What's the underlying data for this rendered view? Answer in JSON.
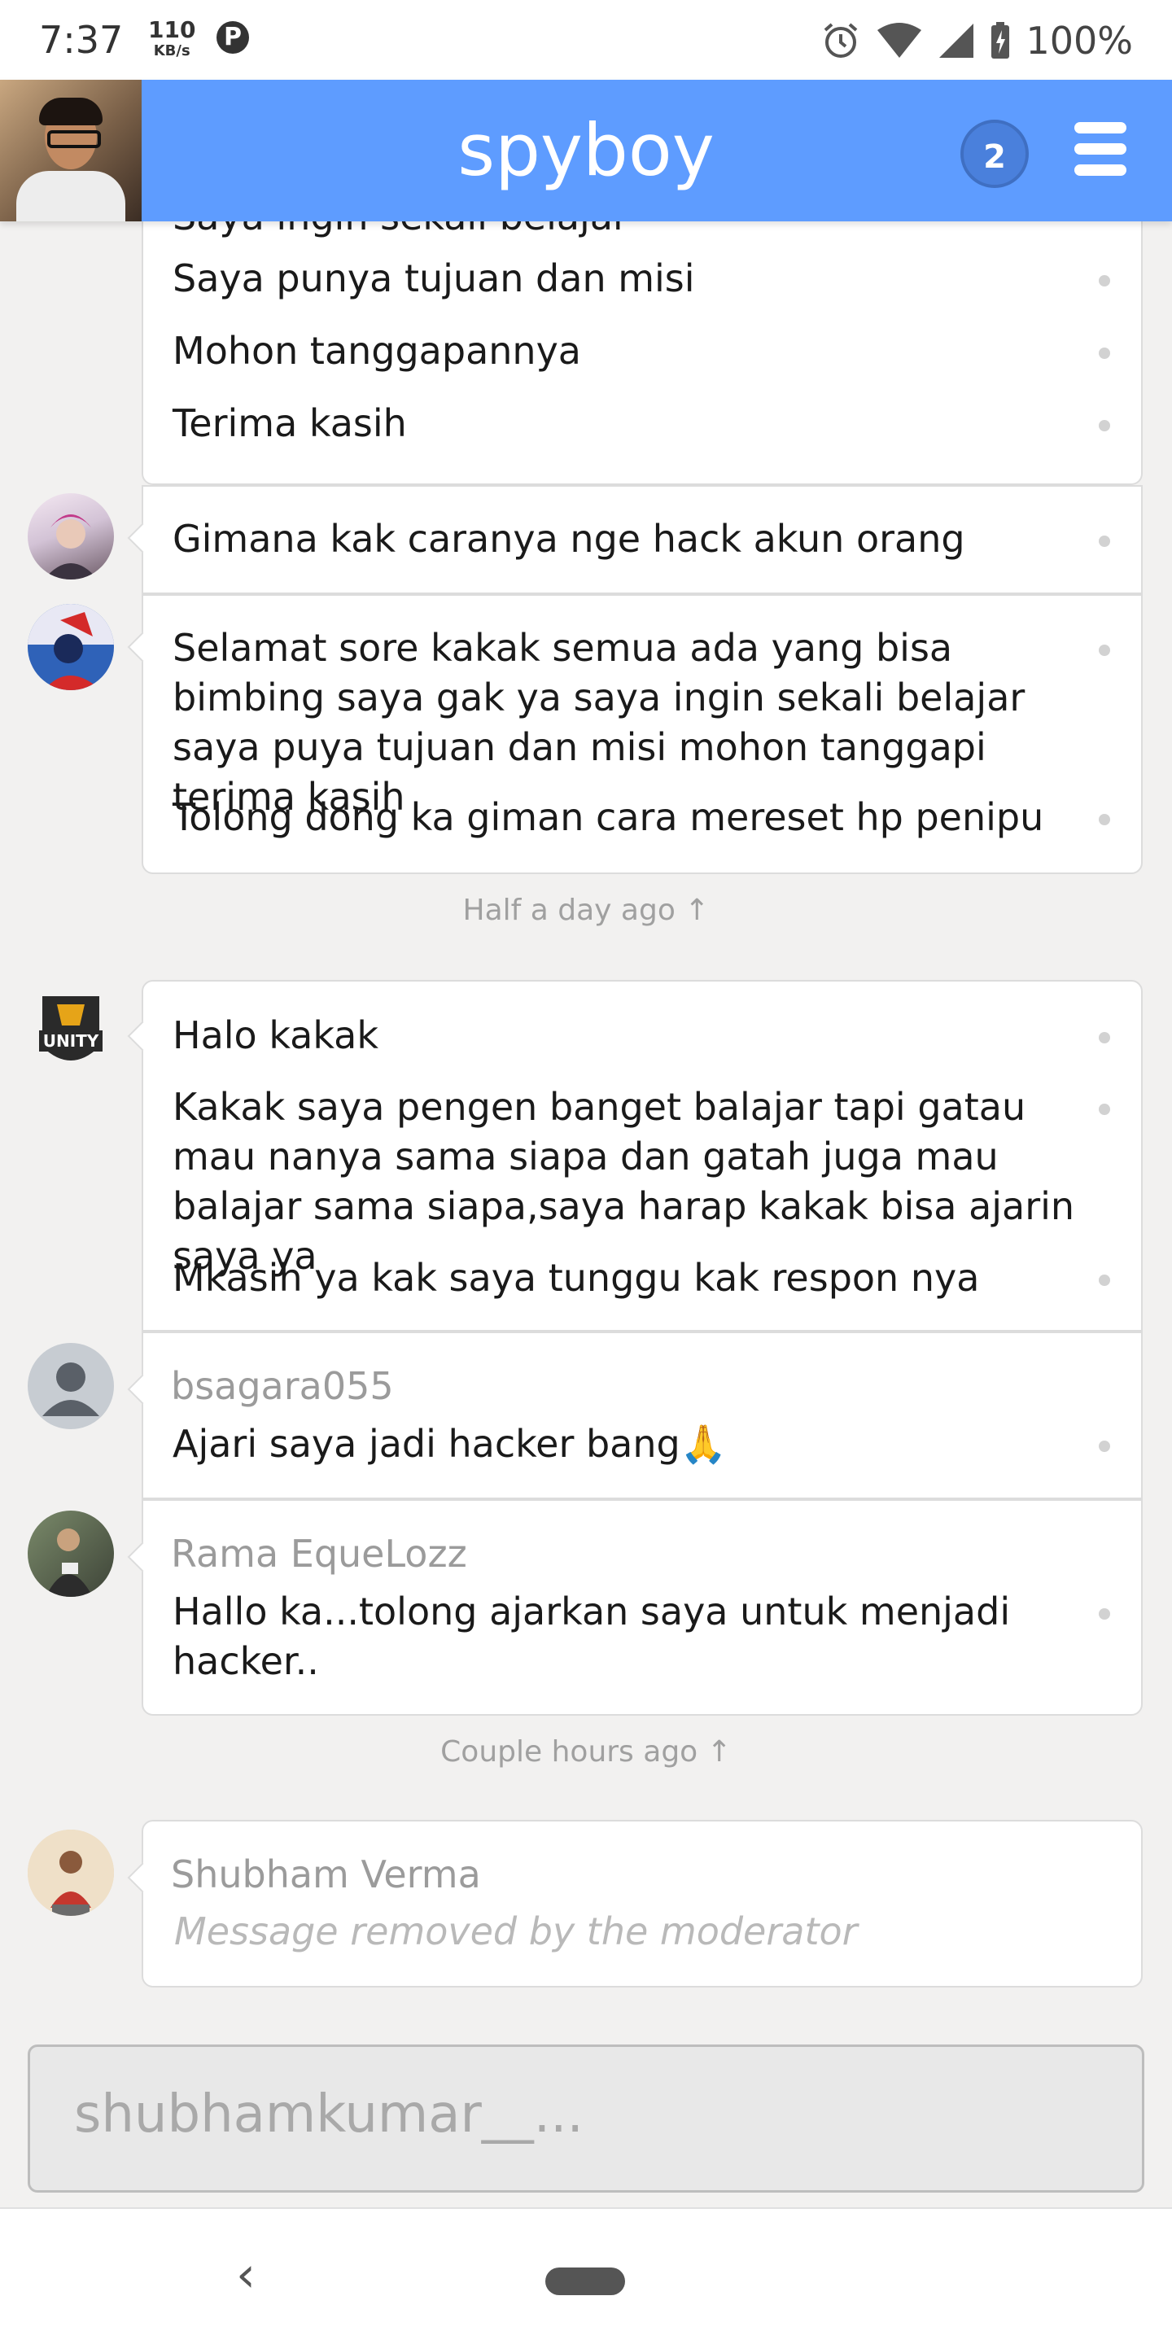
{
  "status_bar": {
    "time": "7:37",
    "speed_value": "110",
    "speed_unit": "KB/s",
    "notification_icon": "P",
    "battery": "100%"
  },
  "header": {
    "title": "spyboy",
    "badge_count": "2"
  },
  "messages": {
    "g1": {
      "partial_line": "Saya ingin sekali belajar",
      "lines": [
        "Saya punya tujuan dan misi",
        "Mohon tanggapannya",
        "Terima kasih"
      ]
    },
    "g2": {
      "lines": [
        "Gimana kak caranya nge hack akun orang"
      ]
    },
    "g3": {
      "lines": [
        "Selamat sore kakak semua ada yang bisa bimbing saya gak ya saya ingin sekali belajar saya puya tujuan dan misi mohon tanggapi terima kasih",
        "Tolong dong ka giman cara mereset hp penipu"
      ]
    },
    "ts1": "Half a day ago ↑",
    "g4": {
      "avatar_text": "UNITY",
      "lines": [
        "Halo kakak",
        "Kakak saya pengen banget balajar tapi gatau mau nanya sama siapa dan gatah juga mau balajar sama siapa,saya harap kakak bisa ajarin saya ya",
        "Mkasih ya kak saya tunggu kak respon nya"
      ]
    },
    "g5": {
      "username": "bsagara055",
      "lines": [
        "Ajari saya jadi hacker bang🙏"
      ]
    },
    "g6": {
      "username": "Rama EqueLozz",
      "lines": [
        "Hallo ka...tolong ajarkan saya untuk menjadi hacker.."
      ]
    },
    "ts2": "Couple hours ago ↑",
    "g7": {
      "username": "Shubham Verma",
      "removed_text": "Message removed by the moderator"
    }
  },
  "input": {
    "placeholder": "shubhamkumar__..."
  },
  "nav": {
    "back_glyph": "‹"
  }
}
